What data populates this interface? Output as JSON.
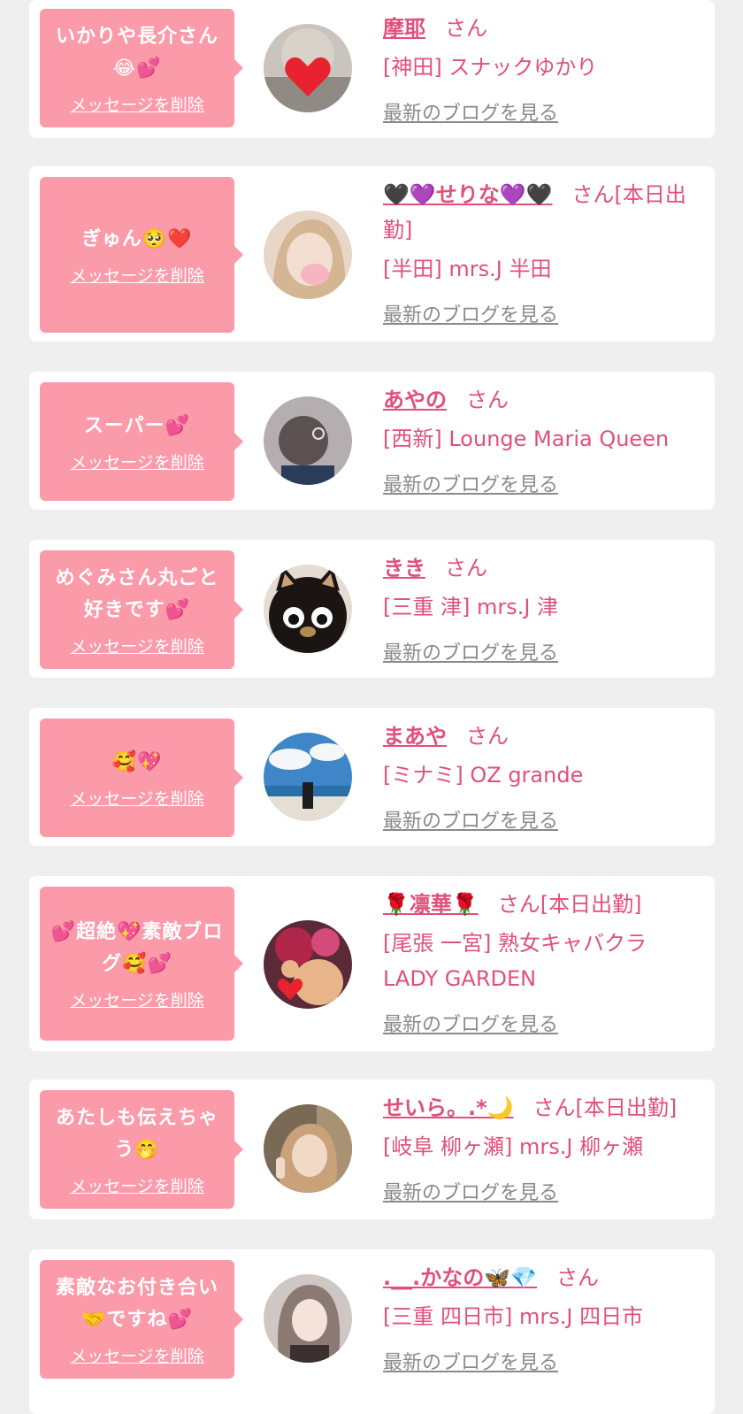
{
  "items": [
    {
      "message": "いかりや長介さん😂💕",
      "delete_label": "メッセージを削除",
      "name": "摩耶",
      "suffix": "さん",
      "shop": "[神田] スナックゆかり",
      "blog_label": "最新のブログを見る",
      "avatar_icon": "heart-face-photo",
      "avatar_colors": [
        "#c9c4bd",
        "#8f8a84"
      ]
    },
    {
      "message": "ぎゅん🥺❤️",
      "delete_label": "メッセージを削除",
      "name": "🖤💜せりな💜🖤",
      "suffix": "さん[本日出勤]",
      "shop": "[半田] mrs.J 半田",
      "blog_label": "最新のブログを見る",
      "avatar_icon": "blonde-selfie-photo",
      "avatar_colors": [
        "#e8d6c6",
        "#b89a7d"
      ]
    },
    {
      "message": "スーパー💕",
      "delete_label": "メッセージを削除",
      "name": "あやの",
      "suffix": "さん",
      "shop": "[西新] Lounge Maria Queen",
      "blog_label": "最新のブログを見る",
      "avatar_icon": "dark-hair-back-photo",
      "avatar_colors": [
        "#b5aeb0",
        "#5b5152"
      ]
    },
    {
      "message": "めぐみさん丸ごと好きです💕",
      "delete_label": "メッセージを削除",
      "name": "きき",
      "suffix": "さん",
      "shop": "[三重 津] mrs.J 津",
      "blog_label": "最新のブログを見る",
      "avatar_icon": "black-cat-character",
      "avatar_colors": [
        "#1a1412",
        "#e6ddd2"
      ]
    },
    {
      "message": "🥰💖",
      "delete_label": "メッセージを削除",
      "name": "まあや",
      "suffix": "さん",
      "shop": "[ミナミ] OZ grande",
      "blog_label": "最新のブログを見る",
      "avatar_icon": "beach-photo",
      "avatar_colors": [
        "#3e86c8",
        "#e4dfd2"
      ]
    },
    {
      "message": "💕超絶💖素敵ブログ🥰💕",
      "delete_label": "メッセージを削除",
      "name": "🌹凛華🌹",
      "suffix": "さん[本日出勤]",
      "shop": "[尾張 一宮] 熟女キャバクラ LADY GARDEN",
      "blog_label": "最新のブログを見る",
      "avatar_icon": "floral-hair-photo",
      "avatar_colors": [
        "#b0264a",
        "#e8b48a"
      ]
    },
    {
      "message": "あたしも伝えちゃう🤭",
      "delete_label": "メッセージを削除",
      "name": "せいら。.*🌙",
      "suffix": "さん[本日出勤]",
      "shop": "[岐阜 柳ヶ瀬] mrs.J 柳ヶ瀬",
      "blog_label": "最新のブログを見る",
      "avatar_icon": "peace-sign-photo",
      "avatar_colors": [
        "#7a6a55",
        "#d6c2a8"
      ]
    },
    {
      "message": "素敵なお付き合い🤝ですね💕",
      "delete_label": "メッセージを削除",
      "name": ".__.かなの🦋💎",
      "suffix": "さん",
      "shop": "[三重 四日市] mrs.J 四日市",
      "blog_label": "最新のブログを見る",
      "avatar_icon": "portrait-photo",
      "avatar_colors": [
        "#cfc7c4",
        "#8b7a74"
      ]
    }
  ]
}
